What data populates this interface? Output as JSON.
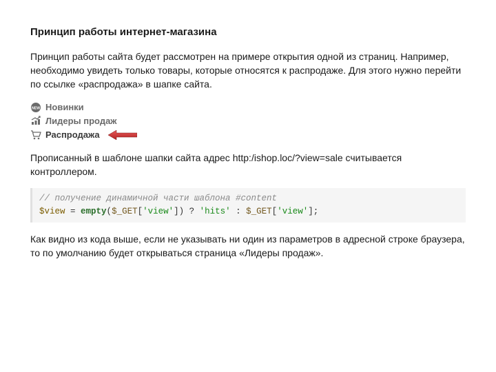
{
  "heading": "Принцип работы интернет-магазина",
  "paragraph1": "Принцип работы сайта будет рассмотрен на примере открытия одной из страниц. Например, необходимо увидеть только товары, которые относятся к распродаже. Для этого нужно перейти по ссылке «распродажа» в шапке сайта.",
  "nav": {
    "item1": "Новинки",
    "item2": "Лидеры продаж",
    "item3": "Распродажа"
  },
  "paragraph2": "Прописанный в шаблоне шапки сайта адрес http:/ishop.loc/?view=sale считывается контроллером.",
  "code": {
    "comment": "// получение динамичной части шаблона #content",
    "var1": "$view",
    "eq": " = ",
    "kw": "empty",
    "open": "(",
    "gvar": "$_GET",
    "br1": "[",
    "s1": "'view'",
    "br2": "]) ? ",
    "s2": "'hits'",
    "col": " : ",
    "gvar2": "$_GET",
    "br3": "[",
    "s3": "'view'",
    "br4": "];"
  },
  "paragraph3": "Как видно из кода выше, если не указывать ни один из параметров в адресной строке браузера, то по умолчанию будет открываться страница «Лидеры продаж»."
}
